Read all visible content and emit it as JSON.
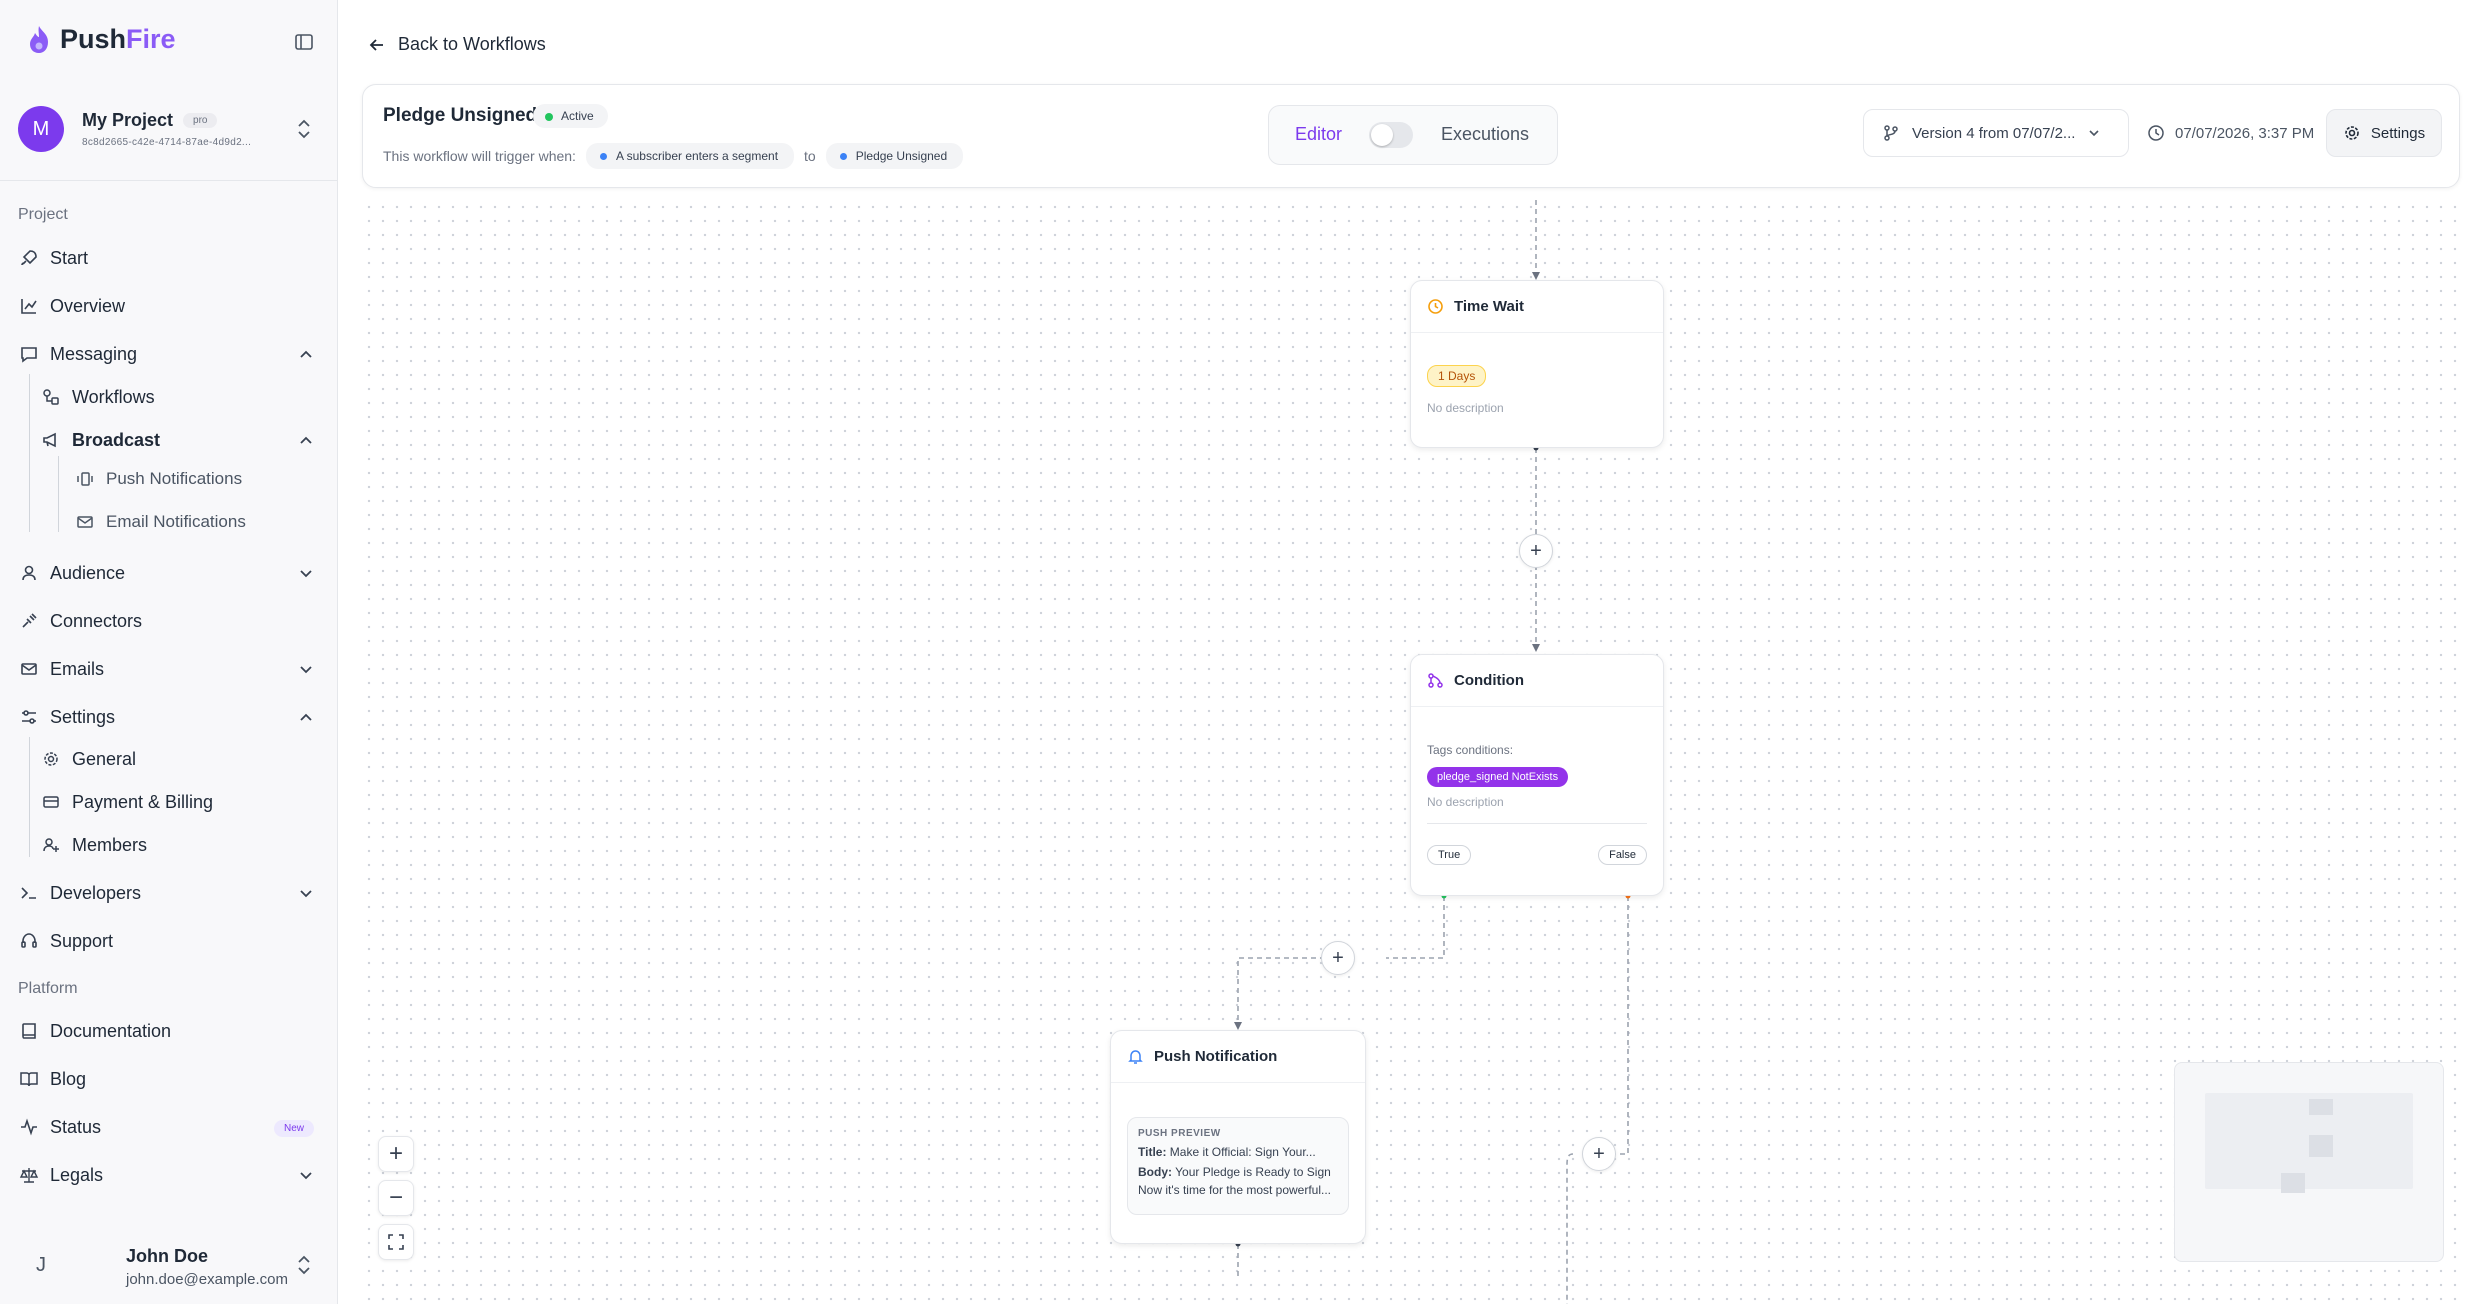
{
  "brand": {
    "name_part1": "Push",
    "name_part2": "Fire"
  },
  "project": {
    "avatar_letter": "M",
    "name": "My Project",
    "plan_badge": "pro",
    "id": "8c8d2665-c42e-4714-87ae-4d9d2..."
  },
  "sidebar": {
    "section_project": "Project",
    "section_platform": "Platform",
    "items": {
      "start": "Start",
      "overview": "Overview",
      "messaging": "Messaging",
      "workflows": "Workflows",
      "broadcast": "Broadcast",
      "push_notifications": "Push Notifications",
      "email_notifications": "Email Notifications",
      "audience": "Audience",
      "connectors": "Connectors",
      "emails": "Emails",
      "settings": "Settings",
      "general": "General",
      "payment_billing": "Payment & Billing",
      "members": "Members",
      "developers": "Developers",
      "support": "Support",
      "documentation": "Documentation",
      "blog": "Blog",
      "status": "Status",
      "status_badge": "New",
      "legals": "Legals"
    }
  },
  "user": {
    "initial": "J",
    "name": "John Doe",
    "email": "john.doe@example.com"
  },
  "back_link": "Back to Workflows",
  "workflow": {
    "title": "Pledge Unsigned",
    "status": "Active",
    "trigger_prefix": "This workflow will trigger when:",
    "trigger_event": "A subscriber enters a segment",
    "trigger_to": "to",
    "trigger_segment": "Pledge Unsigned"
  },
  "mode_toggle": {
    "editor": "Editor",
    "executions": "Executions"
  },
  "version": "Version 4 from 07/07/2...",
  "timestamp": "07/07/2026, 3:37 PM",
  "settings_label": "Settings",
  "nodes": {
    "time_wait": {
      "title": "Time Wait",
      "duration": "1 Days",
      "description": "No description"
    },
    "condition": {
      "title": "Condition",
      "tags_label": "Tags conditions:",
      "tag": "pledge_signed NotExists",
      "description": "No description",
      "true_label": "True",
      "false_label": "False"
    },
    "push": {
      "title": "Push Notification",
      "preview_label": "PUSH PREVIEW",
      "title_key": "Title:",
      "title_value": "Make it Official: Sign Your...",
      "body_key": "Body:",
      "body_value": "Your Pledge is Ready to Sign",
      "body_line2": "Now it's time for the most powerful..."
    }
  },
  "icons": {
    "zoom_in": "plus-icon",
    "zoom_out": "minus-icon",
    "fit": "fit-view-icon"
  },
  "colors": {
    "accent": "#7c3aed",
    "active": "#22c55e",
    "tag": "#9333ea",
    "wait": "#f59e0b"
  }
}
